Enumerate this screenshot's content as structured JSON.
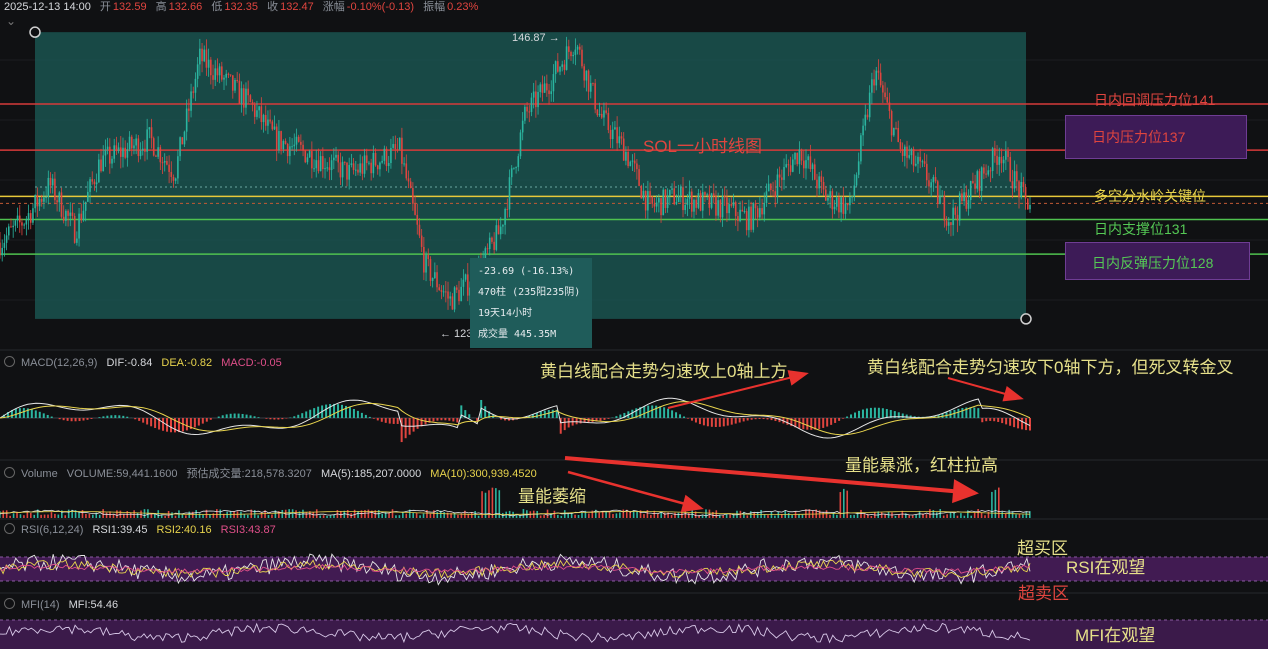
{
  "header": {
    "date": "2025-12-13 14:00",
    "open_label": "开",
    "open": "132.59",
    "high_label": "高",
    "high": "132.66",
    "low_label": "低",
    "low": "132.35",
    "close_label": "收",
    "close": "132.47",
    "change_label": "涨幅",
    "change": "-0.10%(-0.13)",
    "amp_label": "振幅",
    "amp": "0.23%"
  },
  "price_panel": {
    "title": "SOL一小时线图",
    "range_high_label": "146.87 →",
    "range_low_label": "← 123.0",
    "levels": [
      {
        "label": "日内回调压力位141",
        "price": 141,
        "color": "#d63a3a",
        "boxed": false
      },
      {
        "label": "日内压力位137",
        "price": 137,
        "color": "#d63a3a",
        "boxed": true
      },
      {
        "label": "多空分水岭关键位",
        "price": 133,
        "color": "#e8c93a",
        "boxed": false
      },
      {
        "label": "日内支撑位131",
        "price": 131,
        "color": "#4fc24f",
        "boxed": false
      },
      {
        "label": "日内反弹压力位128",
        "price": 128,
        "color": "#4fc24f",
        "boxed": true
      }
    ],
    "stats": {
      "change": "-23.69 (-16.13%)",
      "bars": "470柱 (235阳235阴)",
      "duration": "19天14小时",
      "volume": "成交量 445.35M"
    }
  },
  "macd": {
    "name": "MACD(12,26,9)",
    "dif": "DIF:-0.84",
    "dea": "DEA:-0.82",
    "macd": "MACD:-0.05",
    "note_left": "黄白线配合走势匀速攻上0轴上方",
    "note_right": "黄白线配合走势匀速攻下0轴下方，但死叉转金叉"
  },
  "volume": {
    "name": "Volume",
    "vol": "VOLUME:59,441.1600",
    "est": "预估成交量:218,578.3207",
    "ma5": "MA(5):185,207.0000",
    "ma10": "MA(10):300,939.4520",
    "note_shrink": "量能萎缩",
    "note_surge": "量能暴涨，红柱拉高"
  },
  "rsi": {
    "name": "RSI(6,12,24)",
    "rsi1": "RSI1:39.45",
    "rsi2": "RSI2:40.16",
    "rsi3": "RSI3:43.87",
    "overbought": "超买区",
    "watch": "RSI在观望",
    "oversold": "超卖区"
  },
  "mfi": {
    "name": "MFI(14)",
    "value": "MFI:54.46",
    "watch": "MFI在观望"
  },
  "chart_data": {
    "type": "line",
    "title": "SOL一小时线图",
    "x": [
      0,
      25,
      50,
      75,
      100,
      125,
      150,
      175,
      200,
      225,
      250,
      275,
      300,
      325,
      350,
      375,
      400,
      425,
      450,
      475,
      500,
      525,
      550,
      575,
      600,
      625,
      650,
      675,
      700,
      725,
      750,
      775,
      800,
      825,
      850,
      875,
      900,
      925,
      950,
      975,
      1000,
      1025
    ],
    "series": [
      {
        "values": [
          129,
          131,
          134,
          130,
          136,
          137,
          138,
          135,
          145,
          143,
          141,
          138,
          137,
          136,
          135,
          136,
          137,
          127,
          124,
          126,
          130,
          140,
          143,
          146.5,
          140,
          137,
          132,
          133,
          132.5,
          132,
          131,
          134,
          137,
          133,
          132,
          144,
          137,
          135,
          131,
          134,
          137,
          132.5
        ]
      }
    ],
    "ylim": [
      121,
      150
    ],
    "price_range": {
      "high": 146.87,
      "low": 123.0
    },
    "xlabel": "",
    "ylabel": ""
  }
}
